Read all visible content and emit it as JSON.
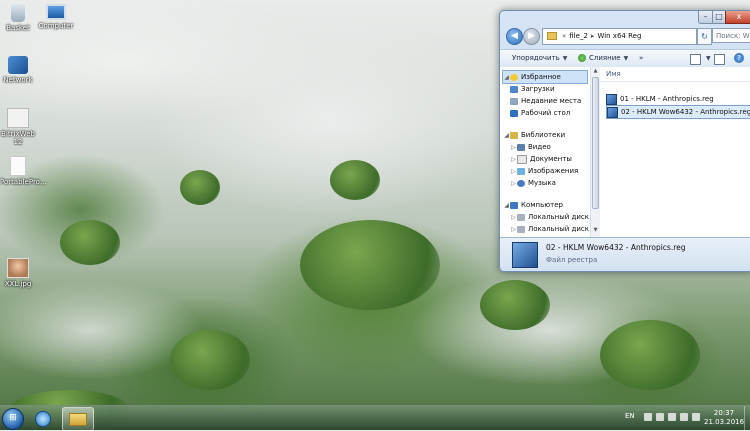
{
  "desktop": {
    "icons": [
      {
        "label": "Basket",
        "icon": "recycle-bin-icon"
      },
      {
        "label": "Computer",
        "icon": "computer-icon"
      },
      {
        "label": "Network",
        "icon": "network-icon"
      },
      {
        "label": "BitrixWeb 12",
        "icon": "application-icon"
      },
      {
        "label": "PortablePro...",
        "icon": "document-icon"
      },
      {
        "label": "XXL.jpg",
        "icon": "image-icon"
      }
    ]
  },
  "explorer": {
    "address": {
      "segments": [
        "file_2",
        "Win x64 Reg"
      ],
      "back_icon": "back-arrow-icon",
      "forward_icon": "forward-arrow-icon",
      "search_placeholder": "Поиск: Win"
    },
    "toolbar": {
      "organize_label": "Упорядочить",
      "merge_label": "Слияние",
      "more_label": "»"
    },
    "nav": {
      "favorites": "Избранное",
      "favorites_items": [
        "Загрузки",
        "Недавние места",
        "Рабочий стол"
      ],
      "libraries": "Библиотеки",
      "libraries_items": [
        "Видео",
        "Документы",
        "Изображения",
        "Музыка"
      ],
      "computer": "Компьютер",
      "computer_items": [
        "Локальный диск (",
        "Локальный диск ("
      ]
    },
    "files": {
      "column_name": "Имя",
      "items": [
        "01 - HKLM - Anthropics.reg",
        "02 - HKLM Wow6432 - Anthropics.reg"
      ],
      "selected_index": 1
    },
    "details": {
      "name": "02 - HKLM Wow6432 - Anthropics.reg",
      "type": "Файл реестра"
    },
    "caption_buttons": {
      "minimize": "–",
      "maximize": "□",
      "close": "x"
    }
  },
  "taskbar": {
    "start_icon": "windows-start-orb-icon",
    "language": "EN",
    "time": "20:37",
    "date": "21.03.2016"
  },
  "colors": {
    "window_frame": "#c3d7ee",
    "selection": "#dcebfb",
    "close_button": "#c4412a"
  }
}
